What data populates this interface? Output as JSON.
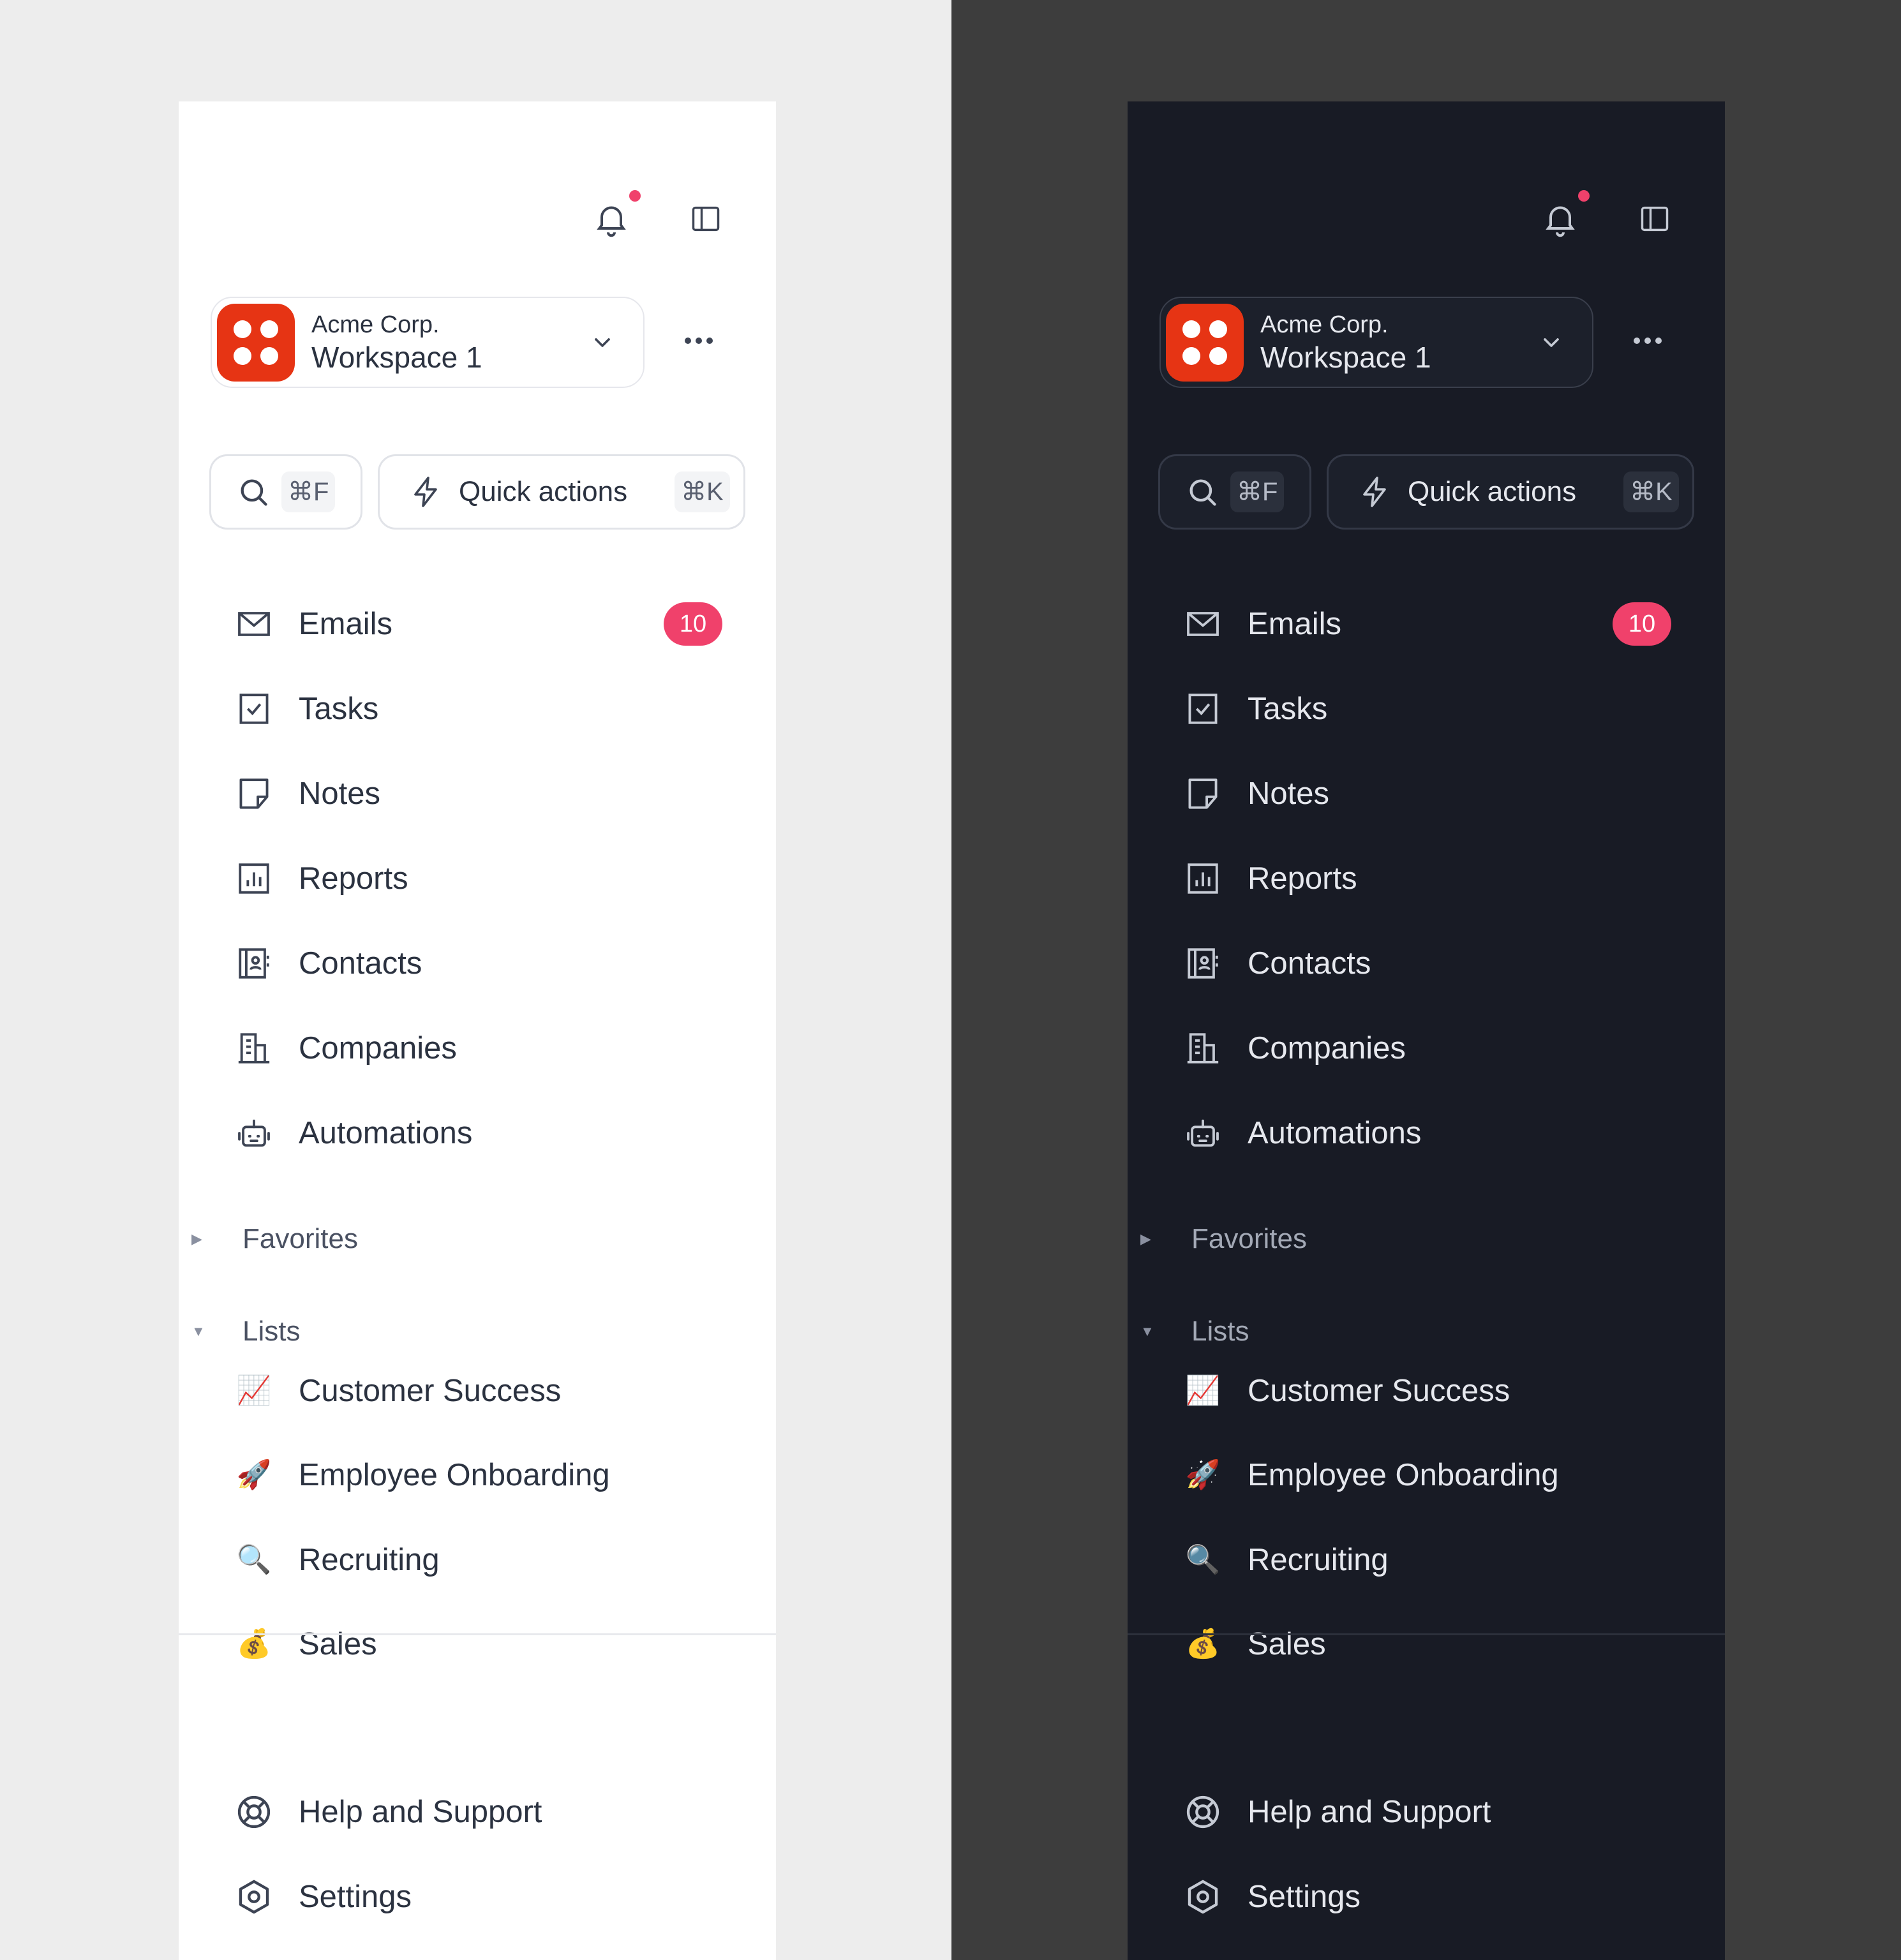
{
  "workspace": {
    "company": "Acme Corp.",
    "name": "Workspace 1"
  },
  "search": {
    "shortcut": "⌘F"
  },
  "quick_actions": {
    "label": "Quick actions",
    "shortcut": "⌘K"
  },
  "nav": [
    {
      "label": "Emails",
      "icon": "mail-icon",
      "badge": "10"
    },
    {
      "label": "Tasks",
      "icon": "checkbox-icon"
    },
    {
      "label": "Notes",
      "icon": "note-icon"
    },
    {
      "label": "Reports",
      "icon": "chart-icon"
    },
    {
      "label": "Contacts",
      "icon": "contacts-icon"
    },
    {
      "label": "Companies",
      "icon": "building-icon"
    },
    {
      "label": "Automations",
      "icon": "robot-icon"
    }
  ],
  "sections": {
    "favorites": "Favorites",
    "lists": "Lists"
  },
  "lists": [
    {
      "label": "Customer Success",
      "emoji": "📈"
    },
    {
      "label": "Employee Onboarding",
      "emoji": "🚀"
    },
    {
      "label": "Recruiting",
      "emoji": "🔍"
    },
    {
      "label": "Sales",
      "emoji": "💰"
    }
  ],
  "footer": [
    {
      "label": "Help and Support",
      "icon": "lifebuoy-icon"
    },
    {
      "label": "Settings",
      "icon": "gear-icon"
    }
  ],
  "colors": {
    "accent": "#f0416b",
    "logo": "#e63414",
    "light_bg": "#ffffff",
    "dark_bg": "#181b25"
  }
}
